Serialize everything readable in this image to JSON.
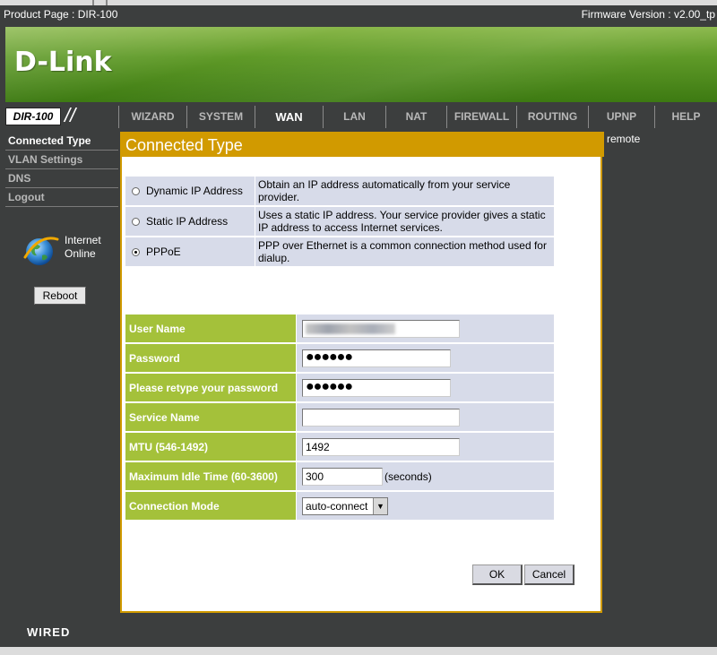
{
  "topbar": {
    "product": "Product Page : DIR-100",
    "firmware": "Firmware Version : v2.00_tp"
  },
  "brand": {
    "logo": "D-Link"
  },
  "nav": {
    "model": "DIR-100",
    "tabs": [
      {
        "label": "WIZARD"
      },
      {
        "label": "SYSTEM"
      },
      {
        "label": "WAN"
      },
      {
        "label": "LAN"
      },
      {
        "label": "NAT"
      },
      {
        "label": "FIREWALL"
      },
      {
        "label": "ROUTING"
      },
      {
        "label": "UPNP"
      },
      {
        "label": "HELP"
      }
    ],
    "active_tab": "WAN"
  },
  "sidebar": {
    "items": [
      {
        "label": "Connected Type"
      },
      {
        "label": "VLAN Settings"
      },
      {
        "label": "DNS"
      },
      {
        "label": "Logout"
      }
    ],
    "status_line1": "Internet",
    "status_line2": "Online",
    "reboot_label": "Reboot"
  },
  "main": {
    "title": "Connected Type",
    "connection_types": [
      {
        "name": "Dynamic IP Address",
        "description": "Obtain an IP address automatically from your service provider.",
        "selected": false
      },
      {
        "name": "Static IP Address",
        "description": "Uses a static IP address. Your service provider gives a static IP address to access Internet services.",
        "selected": false
      },
      {
        "name": "PPPoE",
        "description": "PPP over Ethernet is a common connection method used for dialup.",
        "selected": true
      }
    ],
    "form": {
      "user_name_label": "User Name",
      "password_label": "Password",
      "password_value": "●●●●●●",
      "retype_label": "Please retype your password",
      "retype_value": "●●●●●●",
      "service_name_label": "Service Name",
      "service_name_value": "",
      "mtu_label": "MTU (546-1492)",
      "mtu_value": "1492",
      "idle_label": "Maximum Idle Time (60-3600)",
      "idle_value": "300",
      "idle_unit": "(seconds)",
      "mode_label": "Connection Mode",
      "mode_value": "auto-connect"
    },
    "ok_label": "OK",
    "cancel_label": "Cancel"
  },
  "right_panel": {
    "text": "remote"
  },
  "footer": {
    "text": "WIRED"
  },
  "colors": {
    "dark_bg": "#3c3e3e",
    "title_gold": "#d19a00",
    "label_green": "#a4c13a",
    "row_blue": "#d7dbe9"
  }
}
